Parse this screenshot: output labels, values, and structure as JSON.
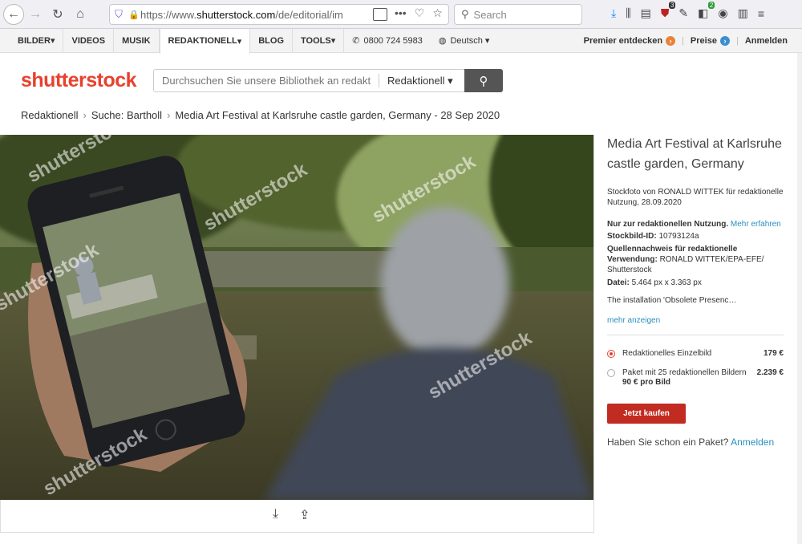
{
  "browser": {
    "url_prefix": "https://www.",
    "url_domain": "shutterstock.com",
    "url_path": "/de/editorial/im",
    "search_placeholder": "Search",
    "ublock_count": "3",
    "ext_count": "2"
  },
  "nav": {
    "items": [
      "BILDER",
      "VIDEOS",
      "MUSIK",
      "REDAKTIONELL",
      "BLOG",
      "TOOLS"
    ],
    "phone": "0800 724 5983",
    "language": "Deutsch",
    "premier": "Premier entdecken",
    "prices": "Preise",
    "login": "Anmelden"
  },
  "header": {
    "logo": "shutterstock",
    "search_placeholder": "Durchsuchen Sie unsere Bibliothek an redaktionellen",
    "category": "Redaktionell"
  },
  "breadcrumb": [
    "Redaktionell",
    "Suche: Bartholl",
    "Media Art Festival at Karlsruhe castle garden, Germany - 28 Sep 2020"
  ],
  "image": {
    "watermark": "shutterstock"
  },
  "panel": {
    "title": "Media Art Festival at Karlsruhe castle garden, Germany",
    "byline": "Stockfoto von RONALD WITTEK für redaktionelle Nutzung, 28.09.2020",
    "usage_label": "Nur zur redaktionellen Nutzung.",
    "usage_link": "Mehr erfahren",
    "id_label": "Stockbild-ID:",
    "id_value": "10793124a",
    "credit_label": "Quellennachweis für redaktionelle Verwendung:",
    "credit_value": "RONALD WITTEK/EPA-EFE/ Shutterstock",
    "file_label": "Datei:",
    "file_value": "5.464 px x 3.363 px",
    "description": "The installation 'Obsolete Presenc…",
    "more": "mehr anzeigen",
    "option1_label": "Redaktionelles Einzelbild",
    "option1_price": "179 €",
    "option2_label": "Paket mit 25 redaktionellen Bildern",
    "option2_sub": "90 € pro Bild",
    "option2_price": "2.239 €",
    "buy": "Jetzt kaufen",
    "package_q": "Haben Sie schon ein Paket?",
    "package_link": "Anmelden"
  },
  "colors": {
    "brand": "#e8412d",
    "buy": "#c22b21",
    "link": "#2a8fbd"
  }
}
